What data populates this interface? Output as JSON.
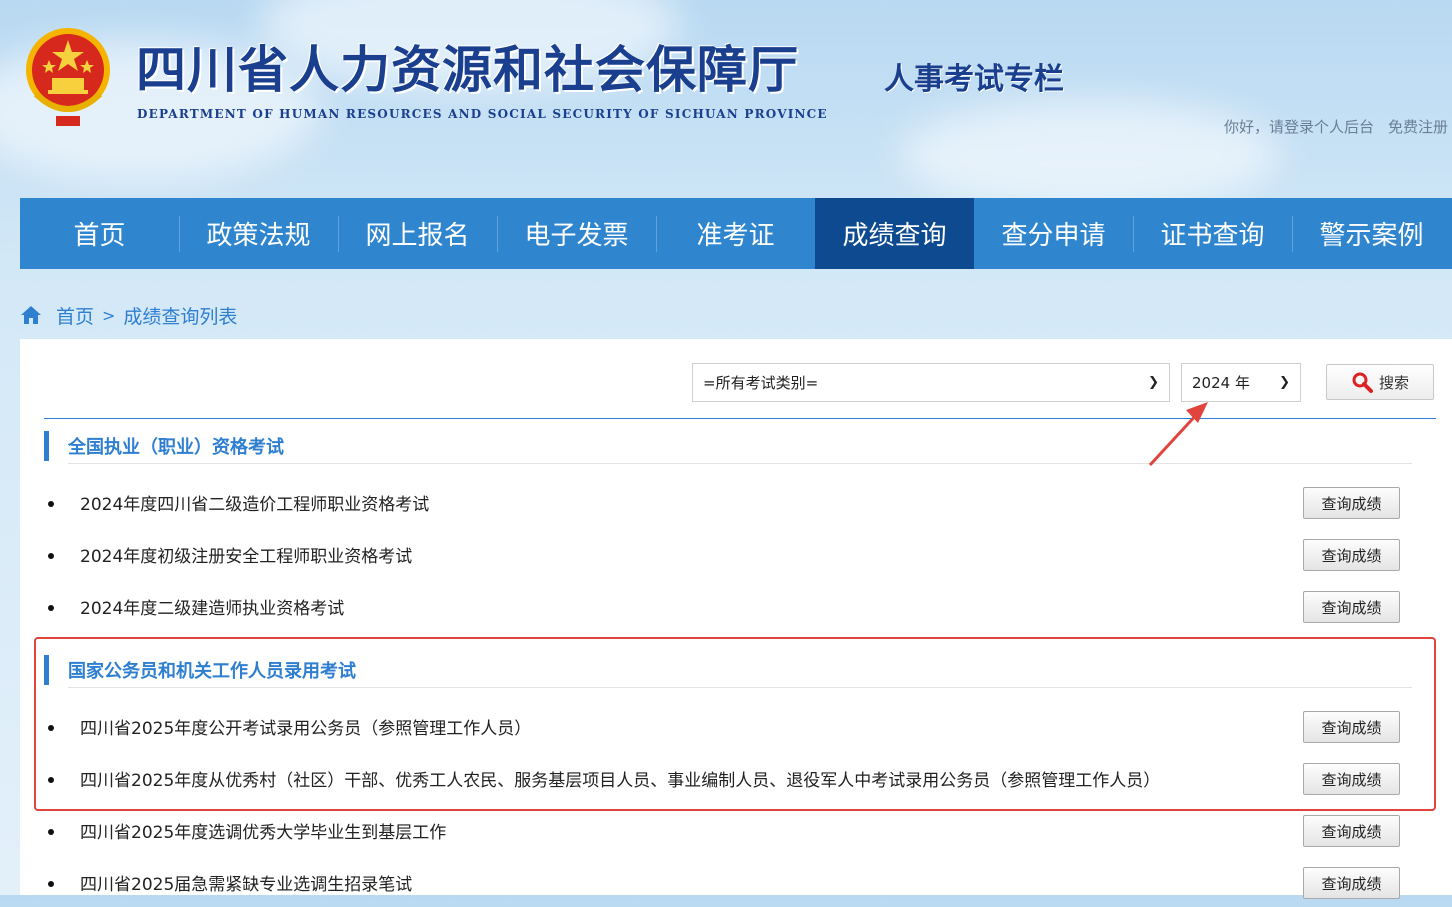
{
  "header": {
    "site_title": "四川省人力资源和社会保障厅",
    "site_subtitle": "DEPARTMENT OF HUMAN RESOURCES AND SOCIAL SECURITY OF SICHUAN PROVINCE",
    "column_title": "人事考试专栏",
    "login_link": "你好，请登录个人后台",
    "register_link": "免费注册",
    "emblem_icon": "national-emblem-icon"
  },
  "nav": {
    "items": [
      {
        "label": "首页"
      },
      {
        "label": "政策法规"
      },
      {
        "label": "网上报名"
      },
      {
        "label": "电子发票"
      },
      {
        "label": "准考证"
      },
      {
        "label": "成绩查询",
        "active": true
      },
      {
        "label": "查分申请"
      },
      {
        "label": "证书查询"
      },
      {
        "label": "警示案例"
      }
    ],
    "color": "#2f86cf",
    "active_color": "#0d4a8f"
  },
  "breadcrumb": {
    "home": "首页",
    "separator": ">",
    "current": "成绩查询列表"
  },
  "filters": {
    "category_value": "=所有考试类别=",
    "year_value": "2024 年",
    "search_label": "搜索"
  },
  "sections": [
    {
      "title": "全国执业（职业）资格考试",
      "exams": [
        {
          "name": "2024年度四川省二级造价工程师职业资格考试",
          "button": "查询成绩"
        },
        {
          "name": "2024年度初级注册安全工程师职业资格考试",
          "button": "查询成绩"
        },
        {
          "name": "2024年度二级建造师执业资格考试",
          "button": "查询成绩"
        }
      ]
    },
    {
      "title": "国家公务员和机关工作人员录用考试",
      "exams": [
        {
          "name": "四川省2025年度公开考试录用公务员（参照管理工作人员）",
          "button": "查询成绩"
        },
        {
          "name": "四川省2025年度从优秀村（社区）干部、优秀工人农民、服务基层项目人员、事业编制人员、退役军人中考试录用公务员（参照管理工作人员）",
          "button": "查询成绩"
        },
        {
          "name": "四川省2025年度选调优秀大学毕业生到基层工作",
          "button": "查询成绩"
        },
        {
          "name": "四川省2025届急需紧缺专业选调生招录笔试",
          "button": "查询成绩"
        }
      ]
    }
  ],
  "annotation_color": "#e0443c"
}
